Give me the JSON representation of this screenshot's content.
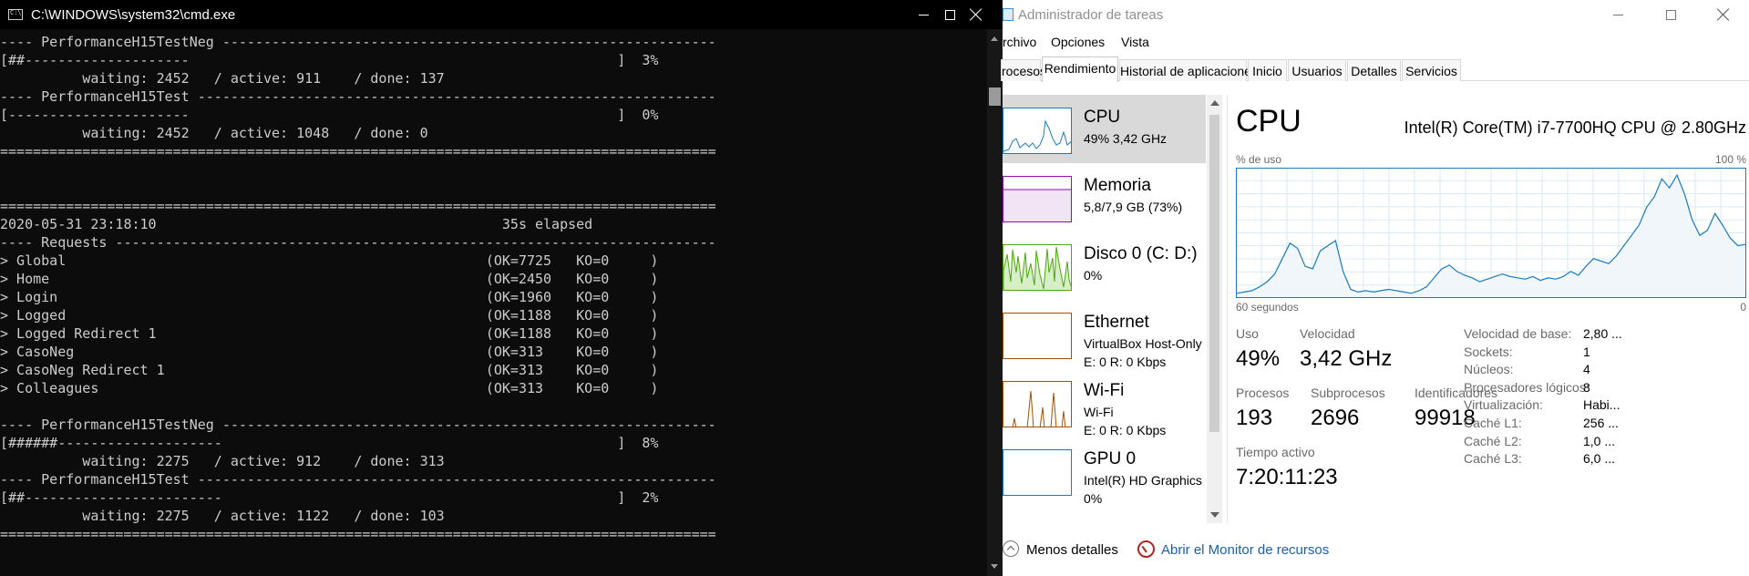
{
  "cmd": {
    "title": "C:\\WINDOWS\\system32\\cmd.exe",
    "lines": [
      "---- PerformanceH15TestNeg ------------------------------------------------------------",
      "[##--------------------                                                    ]  3%",
      "          waiting: 2452   / active: 911    / done: 137",
      "---- PerformanceH15Test ---------------------------------------------------------------",
      "[----------------------                                                    ]  0%",
      "          waiting: 2452   / active: 1048   / done: 0",
      "=======================================================================================",
      "",
      "",
      "=======================================================================================",
      "2020-05-31 23:18:10                                          35s elapsed",
      "---- Requests -------------------------------------------------------------------------",
      "> Global                                                   (OK=7725   KO=0     )",
      "> Home                                                     (OK=2450   KO=0     )",
      "> Login                                                    (OK=1960   KO=0     )",
      "> Logged                                                   (OK=1188   KO=0     )",
      "> Logged Redirect 1                                        (OK=1188   KO=0     )",
      "> CasoNeg                                                  (OK=313    KO=0     )",
      "> CasoNeg Redirect 1                                       (OK=313    KO=0     )",
      "> Colleagues                                               (OK=313    KO=0     )",
      "",
      "---- PerformanceH15TestNeg ------------------------------------------------------------",
      "[######--------------------                                                ]  8%",
      "          waiting: 2275   / active: 912    / done: 313",
      "---- PerformanceH15Test ---------------------------------------------------------------",
      "[##------------------------                                                ]  2%",
      "          waiting: 2275   / active: 1122   / done: 103",
      "======================================================================================="
    ]
  },
  "taskmgr": {
    "title": "Administrador de tareas",
    "menu": [
      "rchivo",
      "Opciones",
      "Vista"
    ],
    "tabs": [
      "rocesos",
      "Rendimiento",
      "Historial de aplicaciones",
      "Inicio",
      "Usuarios",
      "Detalles",
      "Servicios"
    ],
    "active_tab": "Rendimiento",
    "perf_items": [
      {
        "name": "CPU",
        "sub1": "49%  3,42 GHz",
        "sub2": "",
        "color": "#1a7ac0"
      },
      {
        "name": "Memoria",
        "sub1": "5,8/7,9 GB (73%)",
        "sub2": "",
        "color": "#8b12ae"
      },
      {
        "name": "Disco 0 (C: D:)",
        "sub1": "0%",
        "sub2": "",
        "color": "#4da60c"
      },
      {
        "name": "Ethernet",
        "sub1": "VirtualBox Host-Only",
        "sub2": "E: 0  R: 0 Kbps",
        "color": "#a74f01"
      },
      {
        "name": "Wi-Fi",
        "sub1": "Wi-Fi",
        "sub2": "E: 0  R: 0 Kbps",
        "color": "#a74f01"
      },
      {
        "name": "GPU 0",
        "sub1": "Intel(R) HD Graphics",
        "sub2": "0%",
        "color": "#1a7ac0"
      }
    ],
    "detail": {
      "title": "CPU",
      "model": "Intel(R) Core(TM) i7-7700HQ CPU @ 2.80GHz",
      "y_label": "% de uso",
      "y_max_label": "100 %",
      "x_label": "60 segundos",
      "x_min_label": "0",
      "stats": {
        "uso_label": "Uso",
        "uso": "49%",
        "velocidad_label": "Velocidad",
        "velocidad": "3,42 GHz",
        "procesos_label": "Procesos",
        "procesos": "193",
        "subprocesos_label": "Subprocesos",
        "subprocesos": "2696",
        "identificadores_label": "Identificadores",
        "identificadores": "99918",
        "tiempo_label": "Tiempo activo",
        "tiempo": "7:20:11:23"
      },
      "specs": [
        {
          "label": "Velocidad de base:",
          "value": "2,80 ..."
        },
        {
          "label": "Sockets:",
          "value": "1"
        },
        {
          "label": "Núcleos:",
          "value": "4"
        },
        {
          "label": "Procesadores lógicos:",
          "value": "8"
        },
        {
          "label": "Virtualización:",
          "value": "Habi..."
        },
        {
          "label": "Caché L1:",
          "value": "256 ..."
        },
        {
          "label": "Caché L2:",
          "value": "1,0 ..."
        },
        {
          "label": "Caché L3:",
          "value": "6,0 ..."
        }
      ]
    },
    "footer": {
      "fewer_details": "Menos detalles",
      "resource_monitor": "Abrir el Monitor de recursos"
    }
  },
  "chart_data": {
    "type": "area",
    "y_range": [
      0,
      100
    ],
    "x_range": [
      60,
      0
    ],
    "x_direction": "seconds ago, left=60 right=0",
    "values": [
      3,
      4,
      5,
      8,
      12,
      18,
      30,
      42,
      38,
      24,
      22,
      36,
      40,
      44,
      20,
      6,
      4,
      5,
      4,
      5,
      6,
      5,
      4,
      3,
      5,
      8,
      15,
      22,
      25,
      20,
      17,
      15,
      12,
      14,
      16,
      18,
      16,
      15,
      14,
      16,
      13,
      15,
      14,
      16,
      20,
      17,
      24,
      30,
      28,
      26,
      32,
      40,
      48,
      56,
      70,
      78,
      92,
      85,
      95,
      80,
      60,
      48,
      52,
      65,
      56,
      46,
      40,
      41
    ]
  }
}
